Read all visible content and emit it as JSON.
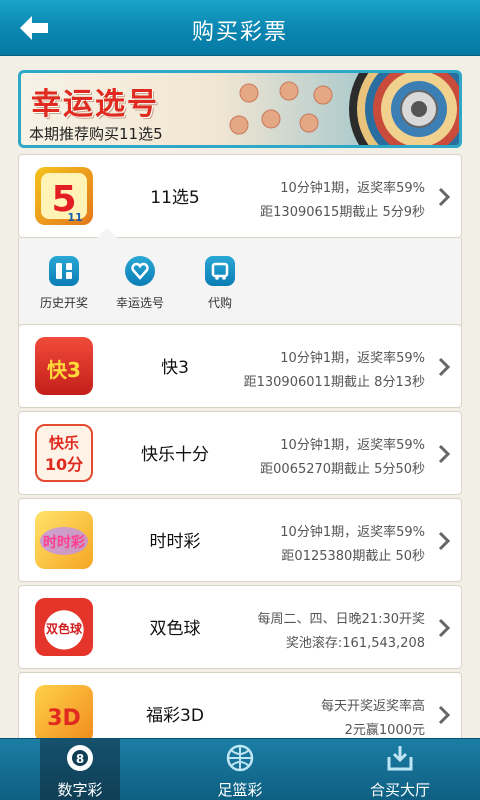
{
  "header": {
    "title": "购买彩票",
    "back_icon": "back-arrow-icon"
  },
  "banner": {
    "title": "幸运选号",
    "subtitle": "本期推荐购买11选5"
  },
  "lotteries": [
    {
      "name": "11选5",
      "line1": "10分钟1期，返奖率59%",
      "line2": "距13090615期截止 5分9秒",
      "logo_text": "5",
      "logo_sub": "11"
    },
    {
      "name": "快3",
      "line1": "10分钟1期，返奖率59%",
      "line2": "距130906011期截止 8分13秒",
      "logo_text": "快3"
    },
    {
      "name": "快乐十分",
      "line1": "10分钟1期，返奖率59%",
      "line2": "距0065270期截止 5分50秒",
      "logo_text": "快乐",
      "logo_sub": "10分"
    },
    {
      "name": "时时彩",
      "line1": "10分钟1期，返奖率59%",
      "line2": "距0125380期截止 50秒",
      "logo_text": "时时彩"
    },
    {
      "name": "双色球",
      "line1": "每周二、四、日晚21:30开奖",
      "line2": "奖池滚存:161,543,208",
      "logo_text": "双色球"
    },
    {
      "name": "福彩3D",
      "line1": "每天开奖返奖率高",
      "line2": "2元赢1000元",
      "logo_text": "3D"
    }
  ],
  "toolbar": [
    {
      "label": "历史开奖",
      "icon": "history-grid-icon"
    },
    {
      "label": "幸运选号",
      "icon": "heart-pick-icon"
    },
    {
      "label": "代购",
      "icon": "cart-icon"
    }
  ],
  "bottom_nav": [
    {
      "label": "数字彩",
      "icon": "eight-ball-icon",
      "active": true
    },
    {
      "label": "足篮彩",
      "icon": "ball-icon"
    },
    {
      "label": "合买大厅",
      "icon": "group-buy-icon"
    }
  ],
  "colors": {
    "header": "#0a86b0",
    "accent": "#e02a1f",
    "nav": "#1c7ea4"
  }
}
